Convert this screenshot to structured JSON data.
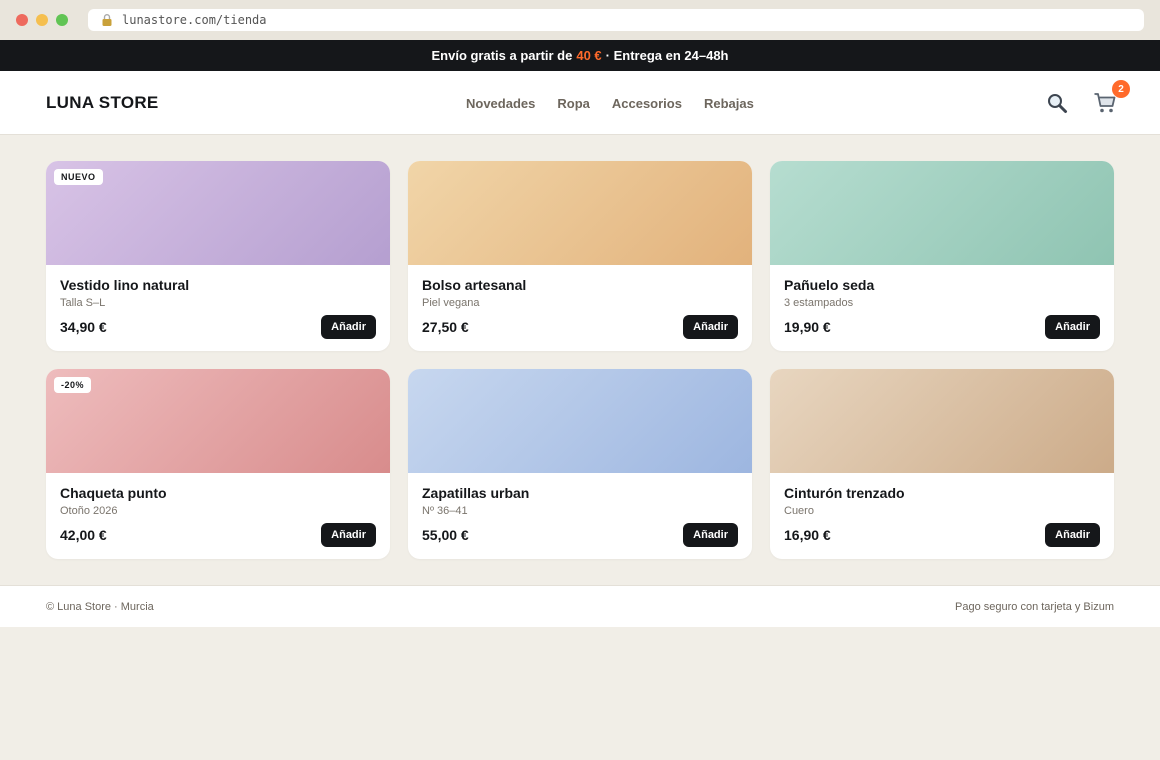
{
  "browser": {
    "url": "lunastore.com/tienda"
  },
  "promo": {
    "pre": "Envío gratis a partir de",
    "highlight": "40 €",
    "post": "· Entrega en 24–48h",
    "accent_color": "#ff6a2b"
  },
  "header": {
    "logo": "LUNA STORE",
    "nav": [
      "Novedades",
      "Ropa",
      "Accesorios",
      "Rebajas"
    ],
    "cart_count": "2",
    "icons": [
      "search-icon",
      "cart-icon"
    ]
  },
  "products": [
    {
      "tag": "NUEVO",
      "name": "Vestido lino natural",
      "sub": "Talla S–L",
      "price": "34,90 €",
      "button": "Añadir",
      "colors": [
        "#d8c3e6",
        "#b59fd0"
      ]
    },
    {
      "tag": "",
      "name": "Bolso artesanal",
      "sub": "Piel vegana",
      "price": "27,50 €",
      "button": "Añadir",
      "colors": [
        "#f1d5a8",
        "#e2b27c"
      ]
    },
    {
      "tag": "",
      "name": "Pañuelo seda",
      "sub": "3 estampados",
      "price": "19,90 €",
      "button": "Añadir",
      "colors": [
        "#b6ddd0",
        "#8fc4b2"
      ]
    },
    {
      "tag": "-20%",
      "name": "Chaqueta punto",
      "sub": "Otoño 2026",
      "price": "42,00 €",
      "button": "Añadir",
      "colors": [
        "#eebcbd",
        "#d88c8c"
      ]
    },
    {
      "tag": "",
      "name": "Zapatillas urban",
      "sub": "Nº 36–41",
      "price": "55,00 €",
      "button": "Añadir",
      "colors": [
        "#c7d7ef",
        "#9db6e0"
      ]
    },
    {
      "tag": "",
      "name": "Cinturón trenzado",
      "sub": "Cuero",
      "price": "16,90 €",
      "button": "Añadir",
      "colors": [
        "#e8d6c0",
        "#ccab89"
      ]
    }
  ],
  "footer": {
    "left": "© Luna Store · Murcia",
    "right": "Pago seguro con tarjeta y Bizum"
  }
}
